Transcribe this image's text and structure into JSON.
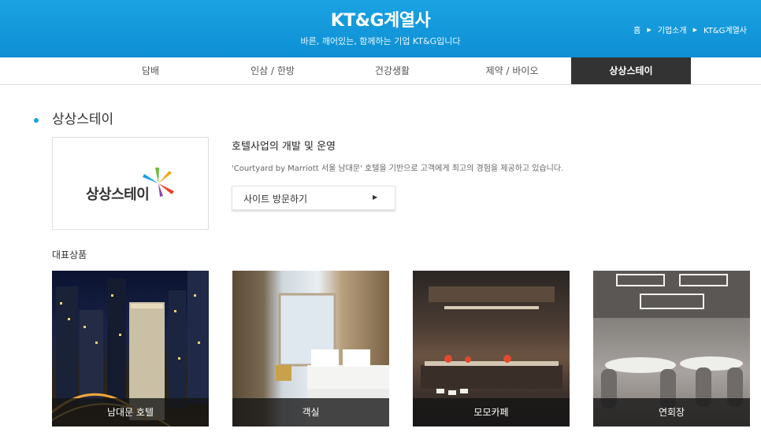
{
  "header": {
    "title": "KT&G계열사",
    "subtitle": "바른, 깨어있는, 함께하는 기업 KT&G입니다",
    "breadcrumb": [
      "홈",
      "기업소개",
      "KT&G계열사"
    ]
  },
  "nav": {
    "items": [
      "담배",
      "인삼 / 한방",
      "건강생활",
      "제약 / 바이오",
      "상상스테이"
    ],
    "active": "상상스테이"
  },
  "section": {
    "title": "상상스테이",
    "logo_text": "상상스테이",
    "desc_title": "호텔사업의 개발 및 운영",
    "desc_text": "'Courtyard by Marriott 서울 남대문' 호텔을 기반으로 고객에게 최고의 경험을 제공하고 있습니다.",
    "visit_label": "사이트 방문하기"
  },
  "products": {
    "title": "대표상품",
    "items": [
      "남대문 호텔",
      "객실",
      "모모카페",
      "연회장"
    ]
  },
  "colors": {
    "header_blue": "#1aa3e3",
    "active_tab": "#333333"
  }
}
